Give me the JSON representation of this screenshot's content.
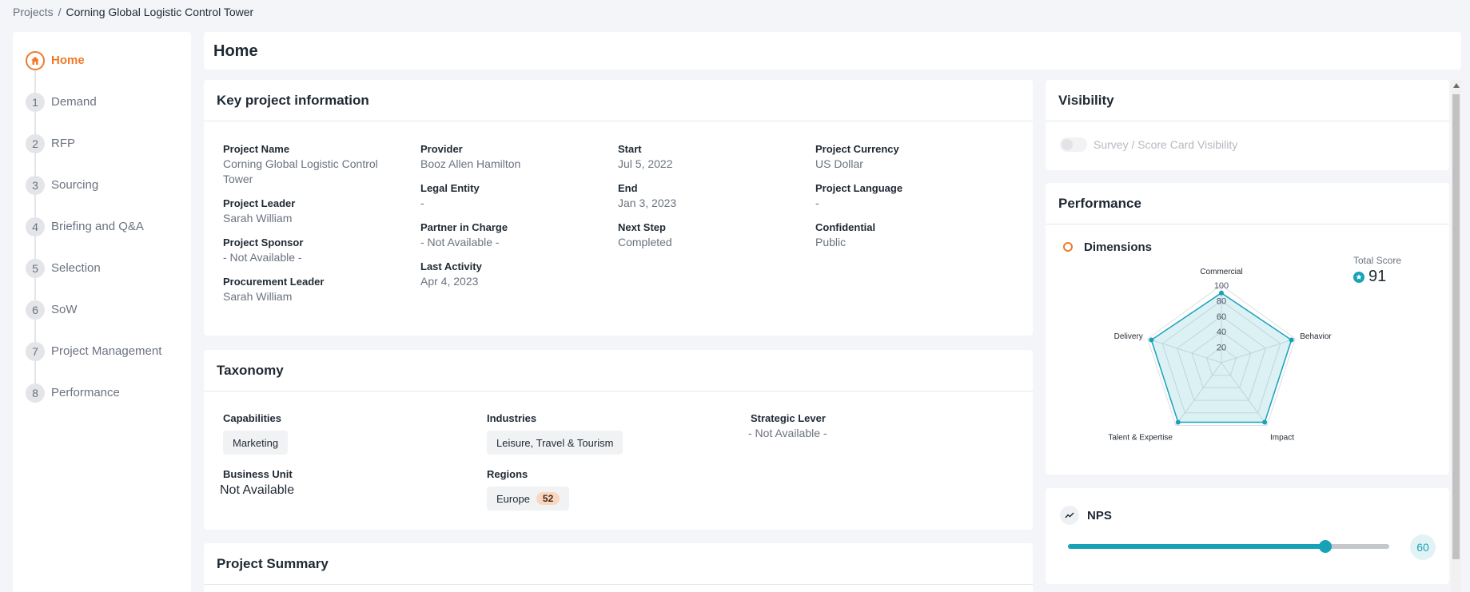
{
  "breadcrumb": {
    "root": "Projects",
    "separator": "/",
    "current": "Corning Global Logistic Control Tower"
  },
  "sidebar": {
    "home": {
      "label": "Home",
      "icon": "home-icon"
    },
    "steps": [
      {
        "num": "1",
        "label": "Demand"
      },
      {
        "num": "2",
        "label": "RFP"
      },
      {
        "num": "3",
        "label": "Sourcing"
      },
      {
        "num": "4",
        "label": "Briefing and Q&A"
      },
      {
        "num": "5",
        "label": "Selection"
      },
      {
        "num": "6",
        "label": "SoW"
      },
      {
        "num": "7",
        "label": "Project Management"
      },
      {
        "num": "8",
        "label": "Performance"
      }
    ]
  },
  "header": {
    "title": "Home"
  },
  "key_info": {
    "title": "Key project information",
    "project_name": {
      "label": "Project Name",
      "value": "Corning Global Logistic Control Tower"
    },
    "project_leader": {
      "label": "Project Leader",
      "value": "Sarah William"
    },
    "project_sponsor": {
      "label": "Project Sponsor",
      "value": "- Not Available -"
    },
    "procurement_leader": {
      "label": "Procurement Leader",
      "value": "Sarah William"
    },
    "provider": {
      "label": "Provider",
      "value": "Booz Allen Hamilton"
    },
    "legal_entity": {
      "label": "Legal Entity",
      "value": "-"
    },
    "partner_in_charge": {
      "label": "Partner in Charge",
      "value": "- Not Available -"
    },
    "last_activity": {
      "label": "Last Activity",
      "value": "Apr 4, 2023"
    },
    "start": {
      "label": "Start",
      "value": "Jul 5, 2022"
    },
    "end": {
      "label": "End",
      "value": "Jan 3, 2023"
    },
    "next_step": {
      "label": "Next Step",
      "value": "Completed"
    },
    "currency": {
      "label": "Project Currency",
      "value": "US Dollar"
    },
    "language": {
      "label": "Project Language",
      "value": "-"
    },
    "confidential": {
      "label": "Confidential",
      "value": "Public"
    }
  },
  "taxonomy": {
    "title": "Taxonomy",
    "capabilities": {
      "label": "Capabilities",
      "chip": "Marketing"
    },
    "industries": {
      "label": "Industries",
      "chip": "Leisure, Travel & Tourism"
    },
    "strategic_lever": {
      "label": "Strategic Lever",
      "value": "- Not Available -"
    },
    "business_unit": {
      "label": "Business Unit",
      "value": "Not Available"
    },
    "regions": {
      "label": "Regions",
      "chip": "Europe",
      "badge": "52"
    }
  },
  "summary": {
    "title": "Project Summary"
  },
  "visibility": {
    "title": "Visibility",
    "toggle_label": "Survey / Score Card Visibility",
    "toggle_on": false
  },
  "performance": {
    "title": "Performance",
    "dimensions_label": "Dimensions",
    "total_score_label": "Total Score",
    "total_score": "91",
    "colors": {
      "accent": "#17a2b8",
      "orange": "#f07a29"
    }
  },
  "chart_data": {
    "type": "radar",
    "categories": [
      "Commercial",
      "Behavior",
      "Impact",
      "Talent & Expertise",
      "Delivery"
    ],
    "values": [
      90,
      95,
      95,
      95,
      95
    ],
    "rlim": [
      0,
      100
    ],
    "ticks": [
      "20",
      "40",
      "60",
      "80",
      "100"
    ],
    "grid": true
  },
  "nps": {
    "title": "NPS",
    "value": "60",
    "fraction": 0.8
  }
}
